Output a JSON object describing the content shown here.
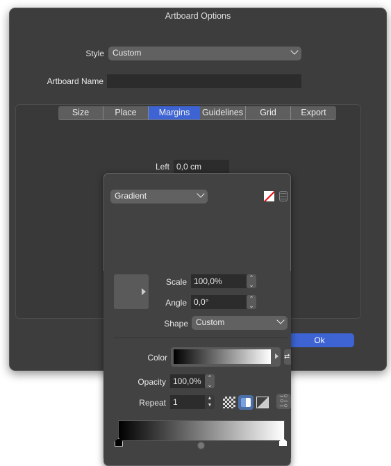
{
  "window": {
    "title": "Artboard Options"
  },
  "style": {
    "label": "Style",
    "value": "Custom"
  },
  "artboard_name": {
    "label": "Artboard Name",
    "value": ""
  },
  "tabs": [
    {
      "label": "Size"
    },
    {
      "label": "Place"
    },
    {
      "label": "Margins",
      "active": true
    },
    {
      "label": "Guidelines"
    },
    {
      "label": "Grid"
    },
    {
      "label": "Export"
    }
  ],
  "margins": {
    "left_label": "Left",
    "left_value": "0,0 cm"
  },
  "ok_label": "Ok",
  "accent": "#3e64d4",
  "popover": {
    "fill_type": "Gradient",
    "scale_label": "Scale",
    "scale_value": "100,0%",
    "angle_label": "Angle",
    "angle_value": "0,0°",
    "shape_label": "Shape",
    "shape_value": "Custom",
    "color_label": "Color",
    "opacity_label": "Opacity",
    "opacity_value": "100,0%",
    "repeat_label": "Repeat",
    "repeat_value": "1",
    "gradient_stops": [
      "#000000",
      "#ffffff"
    ]
  }
}
